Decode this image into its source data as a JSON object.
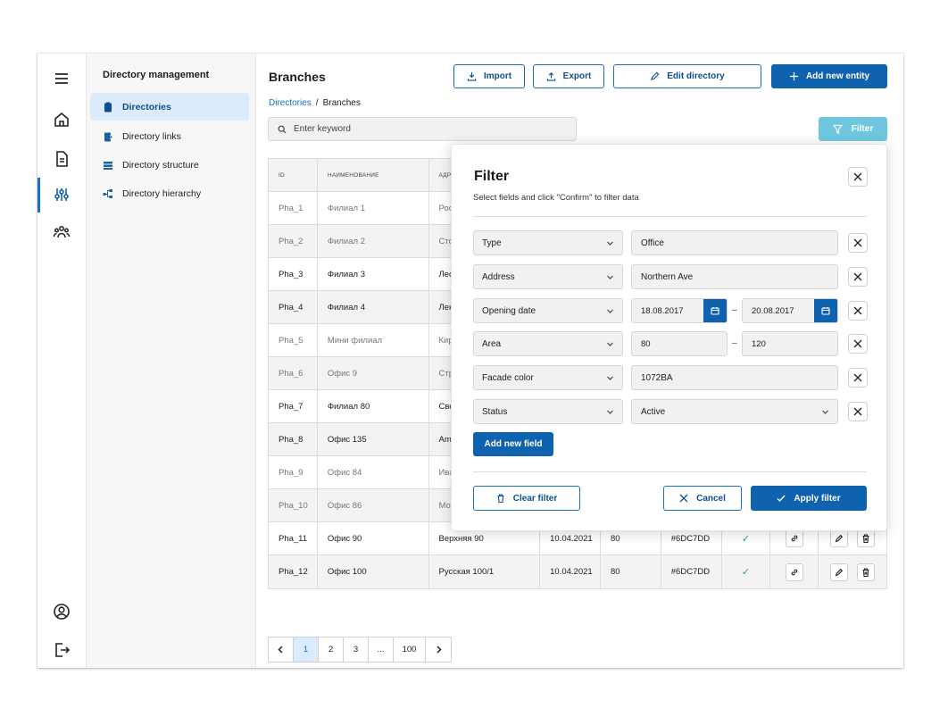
{
  "sidebar": {
    "title": "Directory management",
    "items": [
      {
        "label": "Directories",
        "icon": "clipboard-icon"
      },
      {
        "label": "Directory links",
        "icon": "link-doc-icon"
      },
      {
        "label": "Directory structure",
        "icon": "stack-icon"
      },
      {
        "label": "Directory hierarchy",
        "icon": "hierarchy-icon"
      }
    ]
  },
  "rail": {
    "icons": [
      "menu-icon",
      "home-icon",
      "document-icon",
      "sliders-icon",
      "users-icon",
      "user-circle-icon",
      "logout-icon"
    ],
    "active": "sliders-icon"
  },
  "header": {
    "title": "Branches",
    "import_label": "Import",
    "export_label": "Export",
    "edit_label": "Edit directory",
    "add_label": "Add new entity"
  },
  "breadcrumb": {
    "parent": "Directories",
    "separator": "/",
    "current": "Branches"
  },
  "search": {
    "placeholder": "Enter keyword"
  },
  "filter_button": {
    "label": "Filter"
  },
  "table": {
    "headers": [
      "ID",
      "НАИМЕНОВАНИЕ",
      "АДР"
    ],
    "rows": [
      {
        "id": "Pha_1",
        "name": "Филиал 1",
        "addr": "Рос"
      },
      {
        "id": "Pha_2",
        "name": "Филиал 2",
        "addr": "Стс"
      },
      {
        "id": "Pha_3",
        "name": "Филиал 3",
        "addr": "Лес"
      },
      {
        "id": "Pha_4",
        "name": "Филиал 4",
        "addr": "Лен"
      },
      {
        "id": "Pha_5",
        "name": "Мини филиал",
        "addr": "Кир"
      },
      {
        "id": "Pha_6",
        "name": "Офис 9",
        "addr": "Стр"
      },
      {
        "id": "Pha_7",
        "name": "Филиал 80",
        "addr": "Све"
      },
      {
        "id": "Pha_8",
        "name": "Офис 135",
        "addr": "Am"
      },
      {
        "id": "Pha_9",
        "name": "Офис 84",
        "addr": "Ива"
      },
      {
        "id": "Pha_10",
        "name": "Офис 86",
        "addr": "Мо"
      },
      {
        "id": "Pha_11",
        "name": "Офис 90",
        "addr": "Верхняя 90",
        "date": "10.04.2021",
        "area": "80",
        "color": "#6DC7DD",
        "check": "✓"
      },
      {
        "id": "Pha_12",
        "name": "Офис 100",
        "addr": "Русская 100/1",
        "date": "10.04.2021",
        "area": "80",
        "color": "#6DC7DD",
        "check": "✓"
      }
    ]
  },
  "pagination": {
    "pages": [
      "1",
      "2",
      "3",
      "...",
      "100"
    ],
    "current": "1"
  },
  "filter_panel": {
    "title": "Filter",
    "subtitle": "Select fields and click \"Confirm\" to filter data",
    "rows": [
      {
        "field": "Type",
        "value": "Office"
      },
      {
        "field": "Address",
        "value": "Northern Ave"
      },
      {
        "field": "Opening date",
        "from": "18.08.2017",
        "to": "20.08.2017"
      },
      {
        "field": "Area",
        "from": "80",
        "to": "120"
      },
      {
        "field": "Facade color",
        "value": "1072BA"
      },
      {
        "field": "Status",
        "value": "Active"
      }
    ],
    "range_separator": "–",
    "add_field_label": "Add new field",
    "clear_label": "Clear filter",
    "cancel_label": "Cancel",
    "apply_label": "Apply filter"
  },
  "colors": {
    "accent": "#0f62ad",
    "accent_light": "#dcebfb",
    "filter_button": "#6fc6df",
    "check": "#2aa36b"
  }
}
